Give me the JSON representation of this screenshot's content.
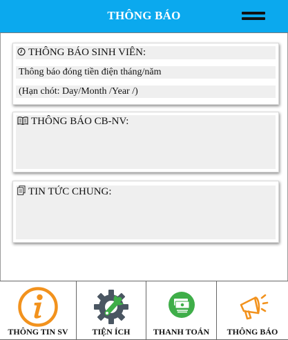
{
  "header": {
    "title": "THÔNG BÁO",
    "menu_icon": "hamburger-menu-icon"
  },
  "sections": {
    "student": {
      "icon": "clock-icon",
      "title": "THÔNG BÁO SINH VIÊN:",
      "lines": [
        "Thông báo đóng tiền điện tháng/năm",
        "(Hạn chót: Day/Month /Year /)"
      ]
    },
    "staff": {
      "icon": "open-book-icon",
      "title": "THÔNG BÁO CB-NV:"
    },
    "news": {
      "icon": "documents-icon",
      "title": "TIN TỨC CHUNG:"
    }
  },
  "tabs": [
    {
      "label": "THÔNG TIN SV",
      "icon": "info-icon",
      "color": "#f2921d"
    },
    {
      "label": "TIỆN ÍCH",
      "icon": "gear-wrench-icon",
      "color": "#4a5662"
    },
    {
      "label": "THANH TOÁN",
      "icon": "money-icon",
      "color": "#3fae49"
    },
    {
      "label": "THÔNG BÁO",
      "icon": "megaphone-icon",
      "color": "#f2921d"
    }
  ],
  "colors": {
    "header_bg": "#0ba9ee",
    "panel_bg": "#efefef"
  }
}
